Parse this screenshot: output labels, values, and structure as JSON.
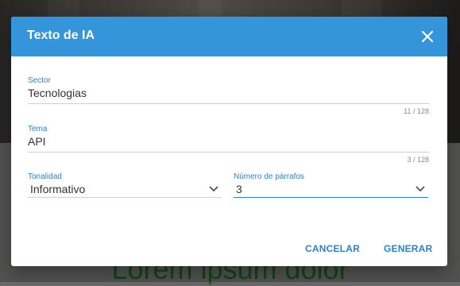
{
  "background": {
    "heading": "...",
    "footer_heading": "Lorem ipsum dolor"
  },
  "dialog": {
    "title": "Texto de IA",
    "fields": {
      "sector": {
        "label": "Sector",
        "value": "Tecnologias",
        "counter": "11 / 128"
      },
      "tema": {
        "label": "Tema",
        "value": "API",
        "counter": "3 / 128"
      },
      "tonalidad": {
        "label": "Tonalidad",
        "value": "Informativo"
      },
      "parrafos": {
        "label": "Número de párrafos",
        "value": "3"
      }
    },
    "buttons": {
      "cancel": "CANCELAR",
      "generate": "GENERAR"
    }
  },
  "colors": {
    "accent": "#3495db",
    "label": "#2b83c9"
  },
  "icons": {
    "close": "close-icon",
    "select": "chevron-down-icon"
  }
}
